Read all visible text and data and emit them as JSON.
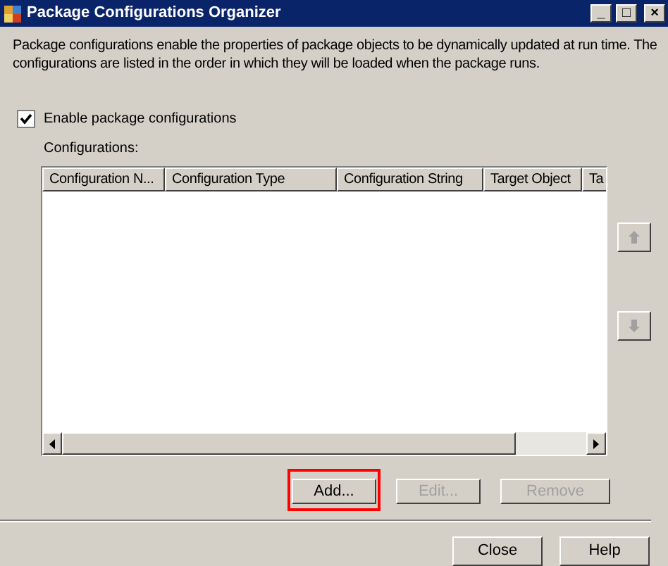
{
  "window": {
    "title": "Package Configurations Organizer",
    "controls": [
      "_",
      "□",
      "×"
    ]
  },
  "description": "Package configurations enable the properties of package objects to be dynamically updated at run time. The configurations are listed in the order in which they will be loaded when the package runs.",
  "enable_checkbox": {
    "label": "Enable package configurations",
    "checked": true
  },
  "configurations_label": "Configurations:",
  "table": {
    "columns": [
      "Configuration N...",
      "Configuration Type",
      "Configuration String",
      "Target Object",
      "Ta"
    ]
  },
  "move_buttons": [
    {
      "kind": "up",
      "disabled": true
    },
    {
      "kind": "down",
      "disabled": true
    }
  ],
  "action_buttons": [
    {
      "label": "Add...",
      "disabled": false,
      "highlighted": true
    },
    {
      "label": "Edit...",
      "disabled": true,
      "highlighted": false
    },
    {
      "label": "Remove",
      "disabled": true,
      "highlighted": false
    }
  ],
  "footer_buttons": [
    {
      "label": "Close"
    },
    {
      "label": "Help"
    }
  ]
}
